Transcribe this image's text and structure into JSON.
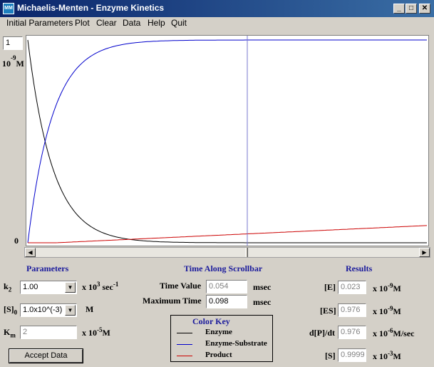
{
  "window": {
    "title": "Michaelis-Menten - Enzyme Kinetics",
    "icon_text": "MM"
  },
  "menu": [
    "Initial Parameters",
    "Plot",
    "Clear",
    "Data",
    "Help",
    "Quit"
  ],
  "plot": {
    "y_scale_value": "1",
    "y_unit_base": "10",
    "y_unit_exp": "-9",
    "y_unit_suffix": "M",
    "y_zero_label": "0",
    "colors": {
      "enzyme": "#000000",
      "enzyme_substrate": "#0000cc",
      "product": "#cc0000",
      "cursor": "#7777cc"
    }
  },
  "scrollbar": {
    "position_fraction": 0.55
  },
  "parameters": {
    "heading": "Parameters",
    "k2": {
      "sym": "k",
      "sub": "2",
      "value": "1.00",
      "unit_prefix": "x 10",
      "unit_exp": "3",
      "unit_suffix": " sec",
      "unit_exp2": "-1"
    },
    "s0": {
      "sym": "[S]",
      "sub": "0",
      "value": "1.0x10^(-3)",
      "unit": "M"
    },
    "km": {
      "sym": "K",
      "sub": "m",
      "value": "2",
      "unit_prefix": "x 10",
      "unit_exp": "-5",
      "unit_suffix": "M"
    },
    "accept_label": "Accept Data"
  },
  "time": {
    "heading": "Time Along Scrollbar",
    "time_value_label": "Time Value",
    "time_value": "0.054",
    "max_time_label": "Maximum Time",
    "max_time": "0.098",
    "unit": "msec"
  },
  "colorkey": {
    "heading": "Color Key",
    "items": [
      "Enzyme",
      "Enzyme-Substrate",
      "Product"
    ]
  },
  "results": {
    "heading": "Results",
    "E": {
      "label": "[E]",
      "value": "0.023",
      "unit_prefix": "x 10",
      "unit_exp": "-9",
      "unit_suffix": "M"
    },
    "ES": {
      "label": "[ES]",
      "value": "0.976",
      "unit_prefix": "x 10",
      "unit_exp": "-9",
      "unit_suffix": "M"
    },
    "dPdt": {
      "label": "d[P]/dt",
      "value": "0.976",
      "unit_prefix": "x 10",
      "unit_exp": "-6",
      "unit_suffix": "M/sec"
    },
    "S": {
      "label": "[S]",
      "value": "0.9999",
      "unit_prefix": "x 10",
      "unit_exp": "-3",
      "unit_suffix": "M"
    }
  }
}
